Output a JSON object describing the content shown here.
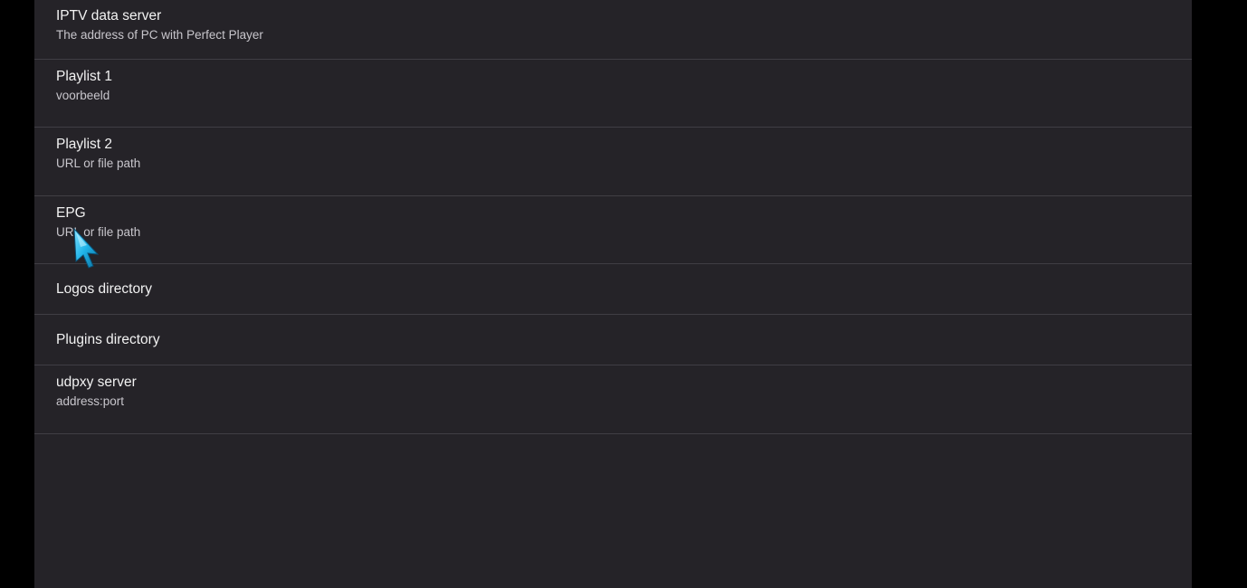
{
  "settings": {
    "items": [
      {
        "title": "IPTV data server",
        "subtitle": "The address of PC with Perfect Player"
      },
      {
        "title": "Playlist 1",
        "subtitle": "voorbeeld"
      },
      {
        "title": "Playlist 2",
        "subtitle": "URL or file path"
      },
      {
        "title": "EPG",
        "subtitle": "URL or file path"
      },
      {
        "title": "Logos directory"
      },
      {
        "title": "Plugins directory"
      },
      {
        "title": "udpxy server",
        "subtitle": "address:port"
      }
    ]
  },
  "colors": {
    "background": "#000000",
    "panel": "#252328",
    "divider": "#403e44",
    "title_text": "#f2f2f2",
    "subtitle_text": "#c8c6cc",
    "cursor": "#1fb3e8"
  },
  "icons": {
    "pointer": "mouse-pointer-icon"
  }
}
